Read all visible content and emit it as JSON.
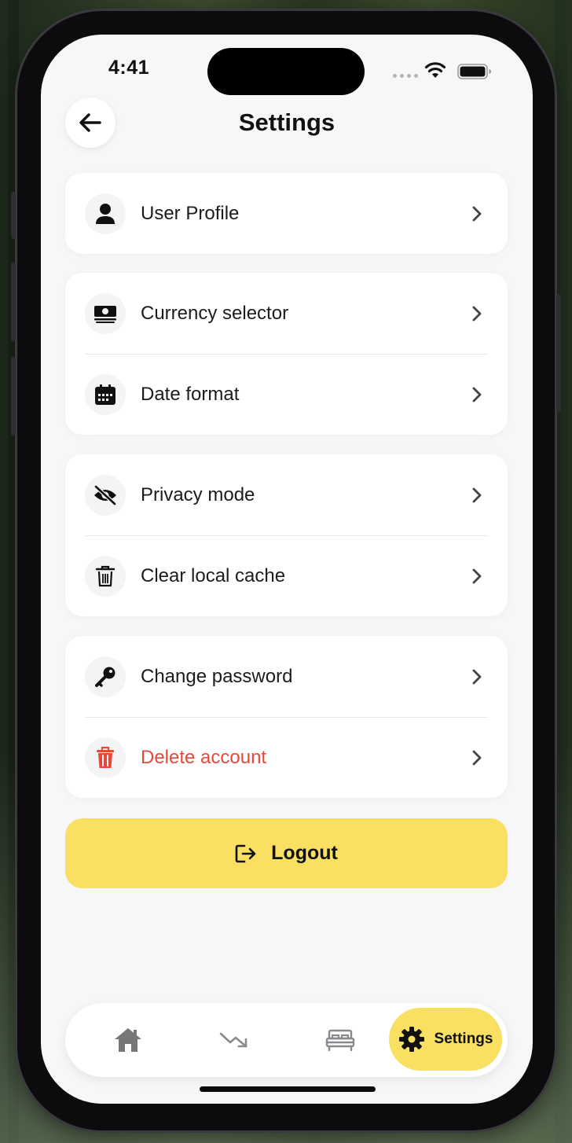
{
  "status_bar": {
    "time": "4:41"
  },
  "header": {
    "title": "Settings"
  },
  "groups": [
    {
      "items": [
        {
          "label": "User Profile",
          "icon": "user-icon"
        }
      ]
    },
    {
      "items": [
        {
          "label": "Currency selector",
          "icon": "money-icon"
        },
        {
          "label": "Date format",
          "icon": "calendar-icon"
        }
      ]
    },
    {
      "items": [
        {
          "label": "Privacy mode",
          "icon": "eye-slash-icon"
        },
        {
          "label": "Clear local cache",
          "icon": "trash-icon"
        }
      ]
    },
    {
      "items": [
        {
          "label": "Change password",
          "icon": "key-icon"
        },
        {
          "label": "Delete account",
          "icon": "trash-icon",
          "color": "#e5493b"
        }
      ]
    }
  ],
  "logout": {
    "label": "Logout",
    "icon": "logout-icon",
    "color": "#f9e063"
  },
  "tab_bar": {
    "items": [
      {
        "icon": "home-icon"
      },
      {
        "icon": "trend-down-icon"
      },
      {
        "icon": "bed-icon"
      },
      {
        "icon": "gear-icon",
        "label": "Settings",
        "active": true
      }
    ]
  },
  "colors": {
    "accent": "#f9e063",
    "danger": "#e5493b",
    "background": "#f6f7f9"
  }
}
